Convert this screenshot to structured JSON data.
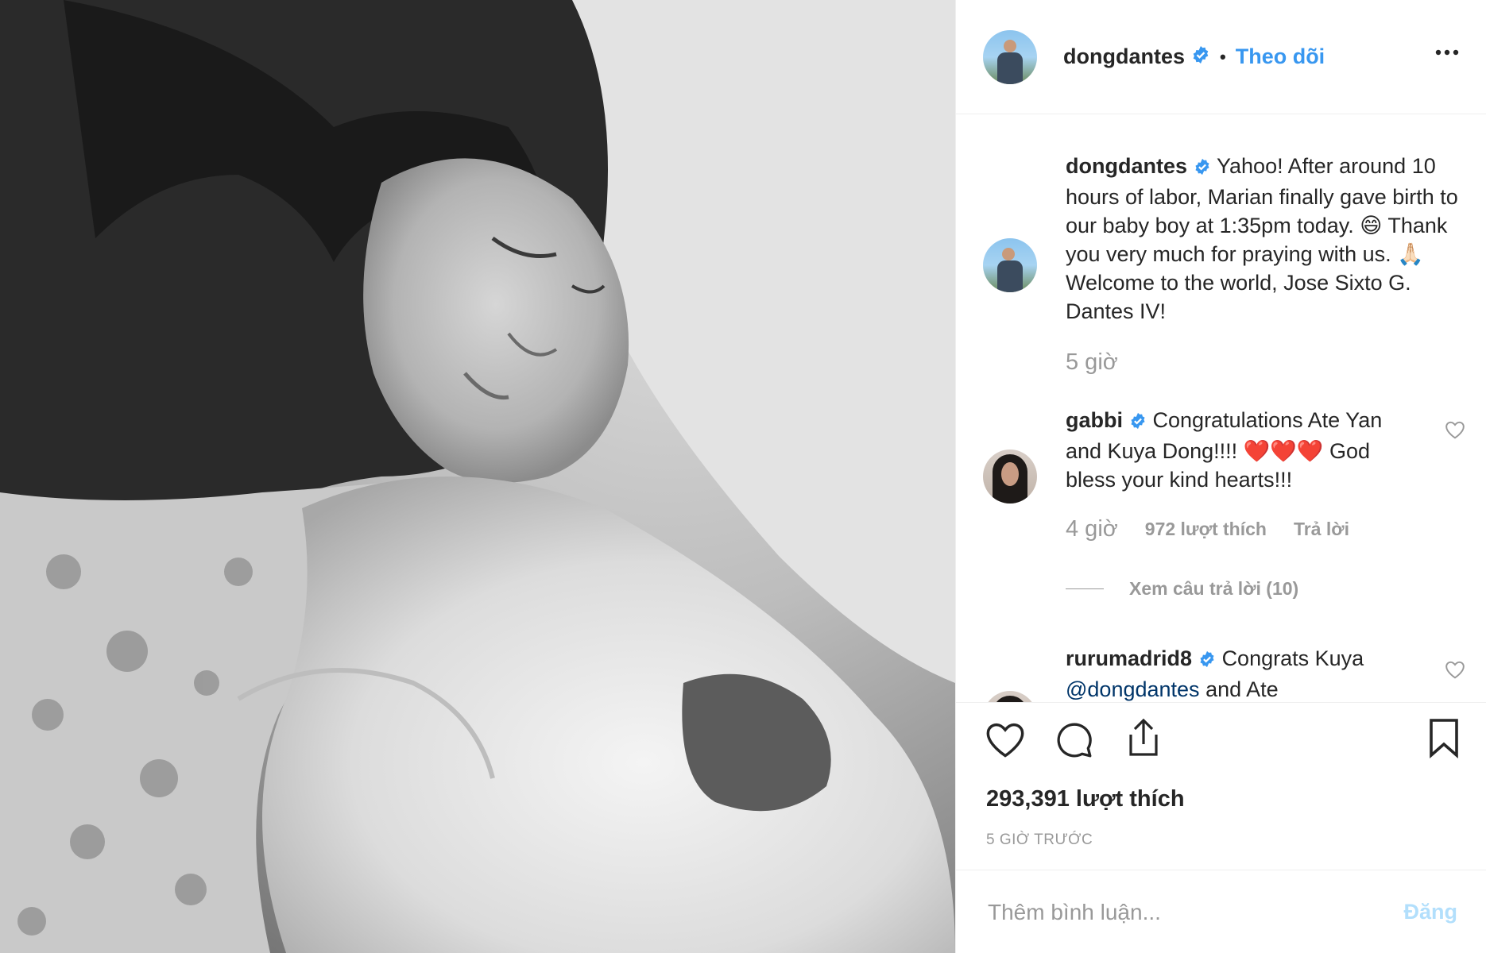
{
  "header": {
    "username": "dongdantes",
    "separator": "•",
    "follow_label": "Theo dõi"
  },
  "caption": {
    "username": "dongdantes",
    "text": "Yahoo! After around 10 hours of labor, Marian finally gave birth to our baby boy at 1:35pm today. 😄 Thank you very much for praying with us. 🙏🏻 Welcome to the world, Jose Sixto G. Dantes IV!",
    "time": "5 giờ"
  },
  "comments": [
    {
      "username": "gabbi",
      "text": "Congratulations Ate Yan and Kuya Dong!!!! ❤️❤️❤️ God bless your kind hearts!!!",
      "time": "4 giờ",
      "likes": "972 lượt thích",
      "reply_label": "Trả lời",
      "view_replies": "Xem câu trả lời (10)"
    },
    {
      "username": "rurumadrid8",
      "text_before": "Congrats Kuya",
      "mention": "@dongdantes",
      "text_after": "and Ate"
    }
  ],
  "stats": {
    "likes": "293,391 lượt thích",
    "posted_ago": "5 GIỜ TRƯỚC"
  },
  "add_comment": {
    "placeholder": "Thêm bình luận...",
    "post_label": "Đăng"
  },
  "colors": {
    "link_blue": "#3897f0",
    "verified_blue": "#3897f0",
    "muted": "#999999",
    "post_disabled": "#b2dffc"
  },
  "icons": [
    "verified-badge-icon",
    "more-options-icon",
    "heart-icon",
    "comment-icon",
    "share-icon",
    "bookmark-icon"
  ]
}
